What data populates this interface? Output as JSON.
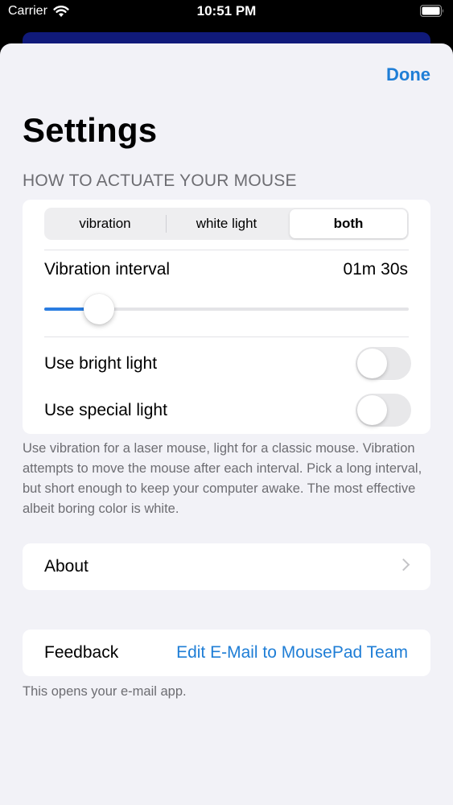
{
  "status_bar": {
    "carrier": "Carrier",
    "time": "10:51 PM"
  },
  "nav": {
    "done_label": "Done"
  },
  "page": {
    "title": "Settings"
  },
  "actuation": {
    "header": "HOW TO ACTUATE YOUR MOUSE",
    "segments": [
      "vibration",
      "white light",
      "both"
    ],
    "selected_segment": "both",
    "interval": {
      "label": "Vibration interval",
      "value": "01m 30s",
      "slider_fraction": 0.15
    },
    "bright_light": {
      "label": "Use bright light",
      "on": false
    },
    "special_light": {
      "label": "Use special light",
      "on": false
    },
    "footer": "Use vibration for a laser mouse, light for a classic mouse. Vibration attempts to move the mouse after each interval. Pick a long interval, but short enough to keep your computer awake. The most effective albeit boring color is white."
  },
  "about": {
    "label": "About"
  },
  "feedback": {
    "label": "Feedback",
    "link": "Edit E-Mail to MousePad Team",
    "footer": "This opens your e-mail app."
  },
  "colors": {
    "accent": "#1f7ed6",
    "slider_fill": "#2a7de1",
    "background": "#f2f2f7"
  }
}
